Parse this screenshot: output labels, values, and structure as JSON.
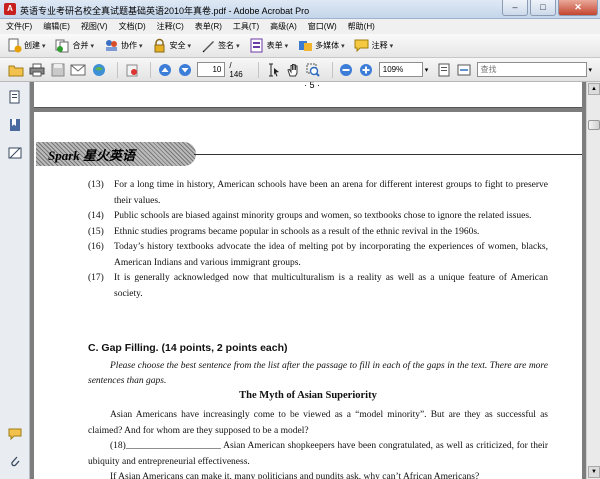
{
  "window": {
    "title": "英语专业考研名校全真试题基础英语2010年真卷.pdf - Adobe Acrobat Pro",
    "app_icon_letter": "A",
    "controls": {
      "minimize": "–",
      "maximize": "□",
      "close": "✕"
    }
  },
  "menu": [
    "文件(F)",
    "编辑(E)",
    "视图(V)",
    "文档(D)",
    "注释(C)",
    "表单(R)",
    "工具(T)",
    "高级(A)",
    "窗口(W)",
    "帮助(H)"
  ],
  "toolbar1": [
    {
      "label": "创建",
      "icon": "create-pdf-icon"
    },
    {
      "label": "合并",
      "icon": "combine-icon"
    },
    {
      "label": "协作",
      "icon": "collaborate-icon"
    },
    {
      "label": "安全",
      "icon": "lock-icon"
    },
    {
      "label": "签名",
      "icon": "pen-icon"
    },
    {
      "label": "表单",
      "icon": "form-icon"
    },
    {
      "label": "多媒体",
      "icon": "multimedia-icon"
    },
    {
      "label": "注释",
      "icon": "comment-icon"
    }
  ],
  "toolbar2": {
    "page_current": "10",
    "page_total": "/ 146",
    "zoom": "109%",
    "search_placeholder": "查找"
  },
  "doc": {
    "prev_page_number": "· 5 ·",
    "banner": "Spark 星火英语",
    "items": [
      {
        "num": "(13)",
        "text": "For a long time in history, American schools have been an arena for different interest groups to fight to preserve their values."
      },
      {
        "num": "(14)",
        "text": "Public schools are biased against minority groups and women, so textbooks chose to ignore the related issues."
      },
      {
        "num": "(15)",
        "text": "Ethnic studies programs became popular in schools as a result of the ethnic revival in the 1960s."
      },
      {
        "num": "(16)",
        "text": "Today’s history textbooks advocate the idea of melting pot by incorporating the experiences of women, blacks, American Indians and various immigrant groups."
      },
      {
        "num": "(17)",
        "text": "It is generally acknowledged now that multiculturalism is a reality as well as a unique feature of American society."
      }
    ],
    "section_title": "C. Gap Filling. (14 points, 2 points each)",
    "instruction": "Please choose the best sentence from the list after the passage to fill in each of the gaps in the text. There are more sentences than gaps.",
    "article_title": "The Myth of Asian Superiority",
    "paragraphs": [
      "Asian Americans have increasingly come to be viewed as a “model minority”. But are they as successful as claimed? And for whom are they supposed to be a model?",
      "(18)____________________ Asian American shopkeepers have been congratulated, as well as criticized, for their ubiquity and entrepreneurial effectiveness.",
      "If Asian Americans can make it, many politicians and pundits ask, why can’t African Americans?"
    ]
  },
  "colors": {
    "accent_pdf_red": "#c8201f",
    "page_gray": "#7d7d7d"
  }
}
